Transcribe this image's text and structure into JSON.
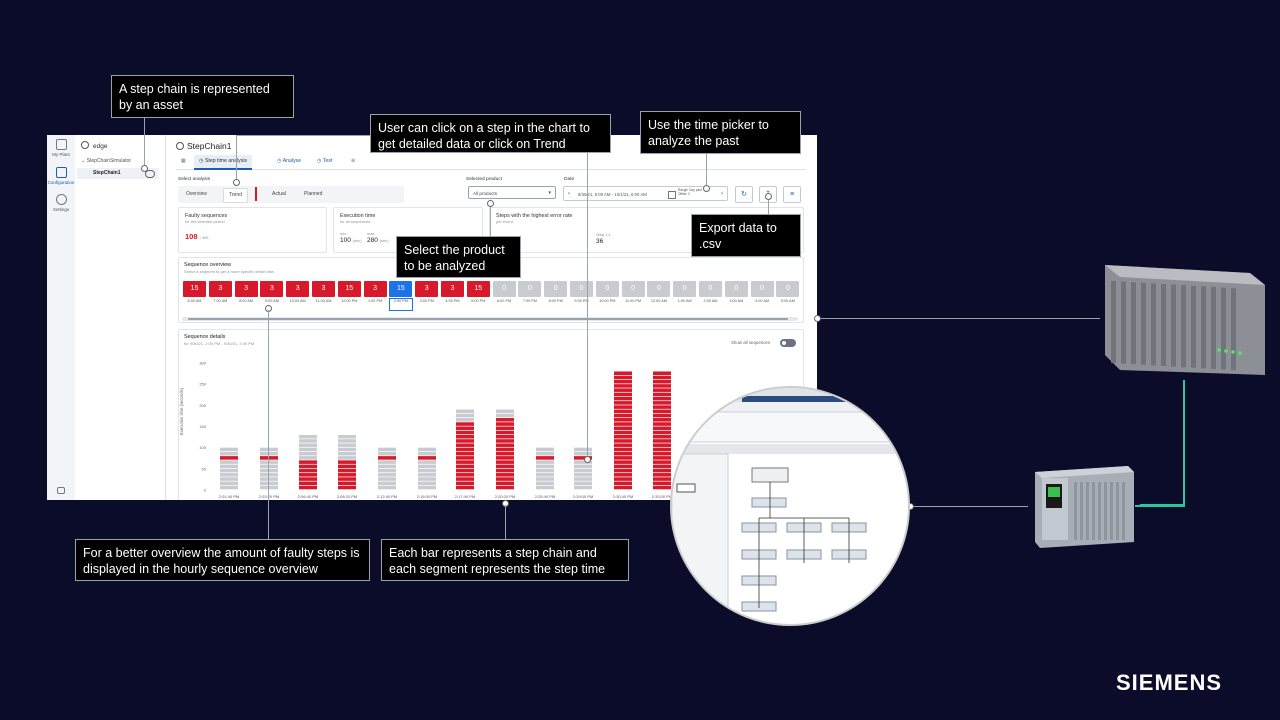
{
  "app": {
    "rail": [
      {
        "label": "My Plant",
        "icon": "plant-icon"
      },
      {
        "label": "Configuration",
        "icon": "configuration-icon"
      },
      {
        "label": "Settings",
        "icon": "settings-icon"
      }
    ],
    "tree": {
      "root": "edge",
      "group": "StepChainSimulator",
      "selected": "StepChain1"
    },
    "asset_title": "StepChain1",
    "tabs": [
      {
        "label": "Step time analysis",
        "selected": true
      },
      {
        "label": "Analyse",
        "selected": false
      },
      {
        "label": "Test",
        "selected": false
      }
    ],
    "select_analysis": {
      "label": "Select analysis",
      "options": [
        "Overview",
        "Trend",
        "Actual",
        "Planned"
      ],
      "selected": "Trend"
    },
    "selected_product": {
      "label": "Selected product",
      "value": "All products"
    },
    "date": {
      "label": "Date",
      "value": "9/30/21, 6:00 AM - 10/1/21, 6:00 AM",
      "extra": "Range: Day past\nOffset: 0"
    },
    "cards": {
      "faulty": {
        "title": "Faulty sequences",
        "subtitle": "for the selected period",
        "value": "108",
        "total": "/ 306"
      },
      "execution": {
        "title": "Execution time",
        "subtitle": "for all sequences",
        "min_label": "min",
        "min_value": "100",
        "min_unit": "(sec)",
        "max_label": "max",
        "max_value": "280",
        "max_unit": "(sec)"
      },
      "steps": {
        "title": "Steps with the highest error rate",
        "subtitle": "per event",
        "step": "Step 1.1",
        "step_value": "36"
      }
    },
    "sequence_overview": {
      "title": "Sequence overview",
      "subtitle": "Select a segment to get a more specific detail view.",
      "blocks": [
        {
          "v": "15",
          "t": "6:00 AM",
          "c": "red"
        },
        {
          "v": "3",
          "t": "7:00 AM",
          "c": "red"
        },
        {
          "v": "3",
          "t": "8:00 AM",
          "c": "red"
        },
        {
          "v": "3",
          "t": "9:00 AM",
          "c": "red"
        },
        {
          "v": "3",
          "t": "10:00 AM",
          "c": "red"
        },
        {
          "v": "3",
          "t": "11:00 AM",
          "c": "red"
        },
        {
          "v": "15",
          "t": "12:00 PM",
          "c": "red"
        },
        {
          "v": "3",
          "t": "1:00 PM",
          "c": "red"
        },
        {
          "v": "15",
          "t": "2:00 PM",
          "c": "blue"
        },
        {
          "v": "3",
          "t": "3:00 PM",
          "c": "red"
        },
        {
          "v": "3",
          "t": "4:00 PM",
          "c": "red"
        },
        {
          "v": "15",
          "t": "5:00 PM",
          "c": "red"
        },
        {
          "v": "0",
          "t": "6:00 PM",
          "c": "gray"
        },
        {
          "v": "0",
          "t": "7:00 PM",
          "c": "gray"
        },
        {
          "v": "0",
          "t": "8:00 PM",
          "c": "gray"
        },
        {
          "v": "0",
          "t": "9:00 PM",
          "c": "gray"
        },
        {
          "v": "0",
          "t": "10:00 PM",
          "c": "gray"
        },
        {
          "v": "0",
          "t": "11:00 PM",
          "c": "gray"
        },
        {
          "v": "0",
          "t": "12:00 AM",
          "c": "gray"
        },
        {
          "v": "0",
          "t": "1:00 AM",
          "c": "gray"
        },
        {
          "v": "0",
          "t": "2:00 AM",
          "c": "gray"
        },
        {
          "v": "0",
          "t": "3:00 AM",
          "c": "gray"
        },
        {
          "v": "0",
          "t": "4:00 AM",
          "c": "gray"
        },
        {
          "v": "0",
          "t": "5:00 AM",
          "c": "gray"
        }
      ]
    },
    "sequence_details": {
      "title": "Sequence details",
      "subtitle": "for 9/30/21, 2:00 PM - 9/30/21, 3:00 PM",
      "toggle_label": "Show all sequences",
      "ylabel": "Execution time (seconds)"
    }
  },
  "chart_data": {
    "type": "bar",
    "title": "Sequence details",
    "ylabel": "Execution time (seconds)",
    "ylim": [
      0,
      300
    ],
    "yticks": [
      0,
      50,
      100,
      150,
      200,
      250,
      300
    ],
    "categories": [
      "2:01:40 PM",
      "2:03:20 PM",
      "2:06:40 PM",
      "2:08:20 PM",
      "2:12:40 PM",
      "2:16:00 PM",
      "2:17:40 PM",
      "2:20:20 PM",
      "2:25:40 PM",
      "2:29:00 PM",
      "2:30:40 PM",
      "2:33:00 PM"
    ],
    "totals": [
      100,
      100,
      130,
      130,
      100,
      100,
      190,
      190,
      100,
      100,
      280,
      280
    ],
    "faulty_start": [
      70,
      70,
      0,
      0,
      70,
      70,
      0,
      0,
      70,
      70,
      0,
      0
    ],
    "faulty_end": [
      80,
      80,
      70,
      70,
      80,
      80,
      160,
      170,
      80,
      80,
      280,
      280
    ]
  },
  "callouts": [
    "A step chain is represented by an asset",
    "User can click on a step in the chart to get detailed data or click on Trend",
    "Use the time picker to analyze the past",
    "Export data to .csv",
    "Select the product to be analyzed",
    "For a better overview  the amount of faulty steps is displayed in the hourly sequence overview",
    "Each bar represents a step chain and each segment represents the step time"
  ],
  "brand": "SIEMENS",
  "colors": {
    "background": "#0b0b2a",
    "accent": "#1a73e8",
    "fault": "#d7192b",
    "connector": "#2ec4a0"
  }
}
